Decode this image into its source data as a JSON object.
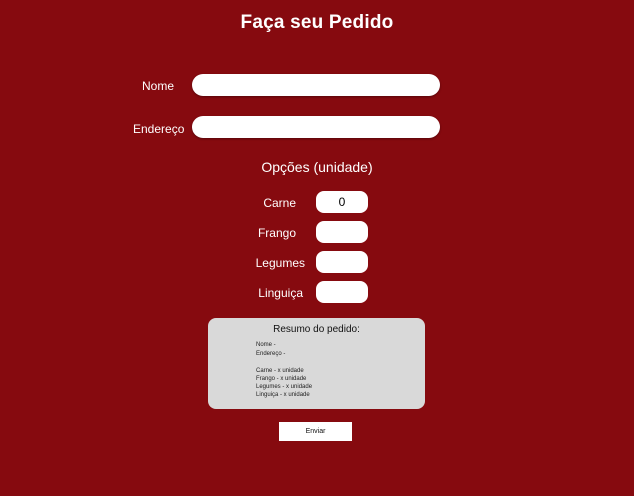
{
  "page": {
    "title": "Faça seu Pedido"
  },
  "form": {
    "name_label": "Nome",
    "name_value": "",
    "address_label": "Endereço",
    "address_value": ""
  },
  "options": {
    "title": "Opções (unidade)",
    "items": [
      {
        "label": "Carne",
        "value": "0"
      },
      {
        "label": "Frango",
        "value": ""
      },
      {
        "label": "Legumes",
        "value": ""
      },
      {
        "label": "Linguiça",
        "value": ""
      }
    ]
  },
  "summary": {
    "title": "Resumo do pedido:",
    "name_line": "Nome -",
    "address_line": "Endereço -",
    "lines": [
      "Carne - x unidade",
      "Frango - x unidade",
      "Legumes - x unidade",
      "Linguiça - x unidade"
    ]
  },
  "actions": {
    "send_label": "Enviar"
  },
  "colors": {
    "background": "#860a0f",
    "input": "#ffffff",
    "summary_box": "#d9d9d9"
  }
}
